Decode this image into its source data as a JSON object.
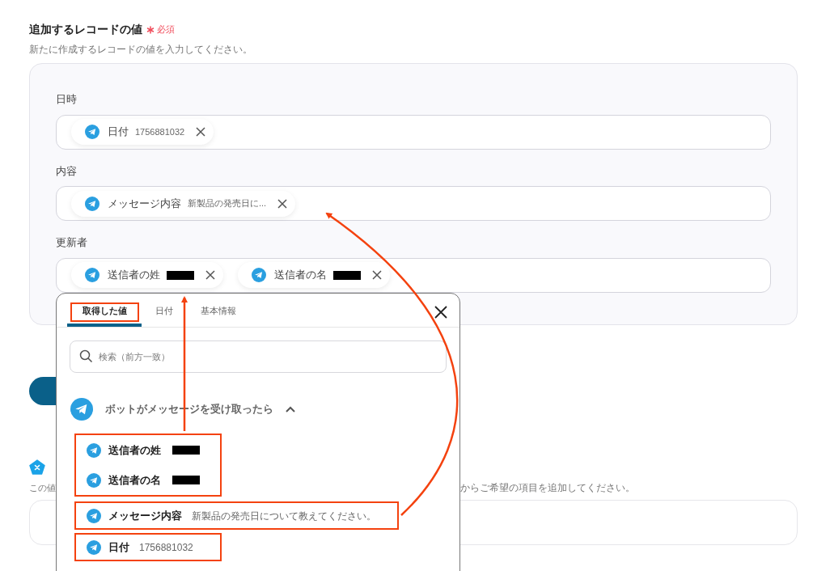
{
  "section": {
    "title": "追加するレコードの値",
    "required_label": "必須",
    "description": "新たに作成するレコードの値を入力してください。"
  },
  "fields": [
    {
      "label": "日時",
      "tokens": [
        {
          "name": "日付",
          "value": "1756881032",
          "redacted": false
        }
      ]
    },
    {
      "label": "内容",
      "tokens": [
        {
          "name": "メッセージ内容",
          "value": "新製品の発売日に...",
          "redacted": false
        }
      ]
    },
    {
      "label": "更新者",
      "tokens": [
        {
          "name": "送信者の姓",
          "redacted": true
        },
        {
          "name": "送信者の名",
          "redacted": true
        }
      ]
    }
  ],
  "next_section": {
    "description_start": "この値",
    "description_end": "からご希望の項目を追加してください。"
  },
  "popup": {
    "tabs": [
      {
        "label": "取得した値",
        "selected": true
      },
      {
        "label": "日付",
        "selected": false
      },
      {
        "label": "基本情報",
        "selected": false
      }
    ],
    "search": {
      "placeholder": "検索（前方一致）"
    },
    "group": {
      "title": "ボットがメッセージを受け取ったら",
      "expanded": true
    },
    "items": [
      {
        "name": "送信者の姓",
        "redacted": true
      },
      {
        "name": "送信者の名",
        "redacted": true
      },
      {
        "name": "メッセージ内容",
        "value": "新製品の発売日について教えてください。",
        "redacted": false
      },
      {
        "name": "日付",
        "value": "1756881032",
        "redacted": false
      }
    ]
  }
}
